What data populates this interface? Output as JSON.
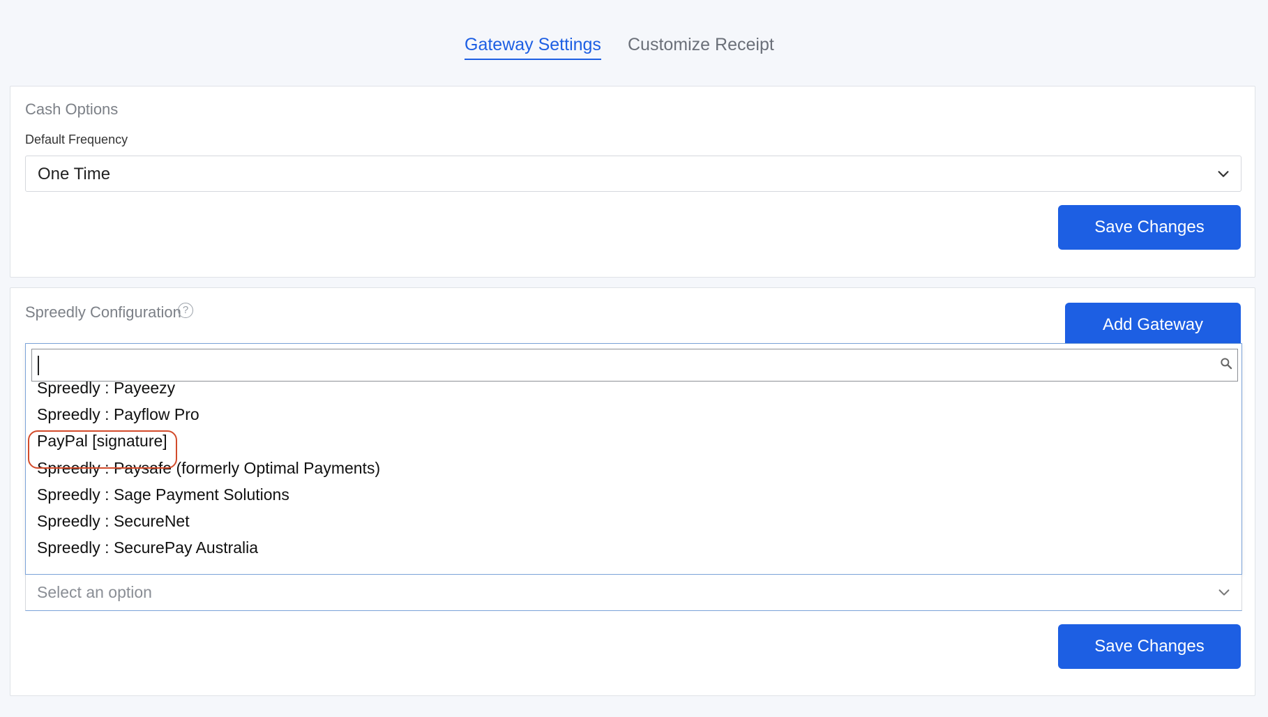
{
  "tabs": [
    {
      "label": "Gateway Settings",
      "active": true
    },
    {
      "label": "Customize Receipt",
      "active": false
    }
  ],
  "cash_options": {
    "title": "Cash Options",
    "frequency_label": "Default Frequency",
    "frequency_value": "One Time",
    "save_label": "Save Changes"
  },
  "spreedly": {
    "title": "Spreedly Configuration",
    "help_glyph": "?",
    "add_gateway_label": "Add Gateway",
    "search_value": "",
    "options": [
      "Spreedly : Payeezy",
      "Spreedly : Payflow Pro",
      "PayPal [signature]",
      "Spreedly : Paysafe (formerly Optimal Payments)",
      "Spreedly : Sage Payment Solutions",
      "Spreedly : SecureNet",
      "Spreedly : SecurePay Australia"
    ],
    "highlighted_option": "PayPal [signature]",
    "select_placeholder": "Select an option",
    "save_label": "Save Changes"
  },
  "colors": {
    "accent": "#1d5fe3",
    "highlight_ring": "#d24b2b",
    "page_bg": "#f5f7fb"
  }
}
